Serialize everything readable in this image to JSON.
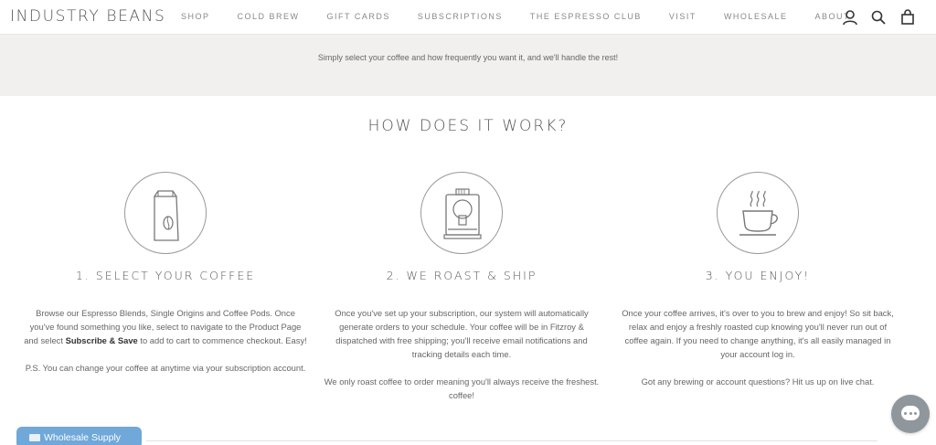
{
  "header": {
    "logo": "INDUSTRY BEANS",
    "nav": [
      "SHOP",
      "COLD BREW",
      "GIFT CARDS",
      "SUBSCRIPTIONS",
      "THE ESPRESSO CLUB",
      "VISIT",
      "WHOLESALE",
      "ABOUT"
    ],
    "icons": [
      "account-icon",
      "search-icon",
      "cart-icon"
    ]
  },
  "banner": {
    "text": "Simply select your coffee and how frequently you want it, and we'll handle the rest!"
  },
  "section": {
    "title": "HOW DOES IT WORK?"
  },
  "steps": [
    {
      "icon": "coffee-bag-icon",
      "title": "1. SELECT YOUR COFFEE",
      "para1_before": "Browse our Espresso Blends, Single Origins and Coffee Pods. Once you've found something you like, select to navigate to the Product Page and select ",
      "para1_bold": "Subscribe & Save",
      "para1_after": " to add to cart to commence checkout. Easy!",
      "para2": "P.S. You can change your coffee at anytime via your subscription account."
    },
    {
      "icon": "espresso-machine-icon",
      "title": "2. WE ROAST & SHIP",
      "para1": "Once you've set up your subscription, our system will automatically generate orders to your schedule. Your coffee will be in Fitzroy & dispatched with free shipping; you'll receive email notifications and tracking details each time.",
      "para2": "We only roast coffee to order meaning you'll always receive the freshest. coffee!"
    },
    {
      "icon": "coffee-cup-icon",
      "title": "3. YOU ENJOY!",
      "para1": "Once your coffee arrives, it's over to you to brew and enjoy! So sit back, relax and enjoy a freshly roasted cup knowing you'll never run out of coffee again. If you need to change anything, it's all easily managed in your account log in.",
      "para2": "Got any brewing or account questions? Hit us up on live chat."
    }
  ],
  "wholesale_button": "Wholesale Supply",
  "colors": {
    "banner_bg": "#f1f0ef",
    "wholesale_bg": "#6fa8d9",
    "chat_bg": "#8f969c"
  }
}
